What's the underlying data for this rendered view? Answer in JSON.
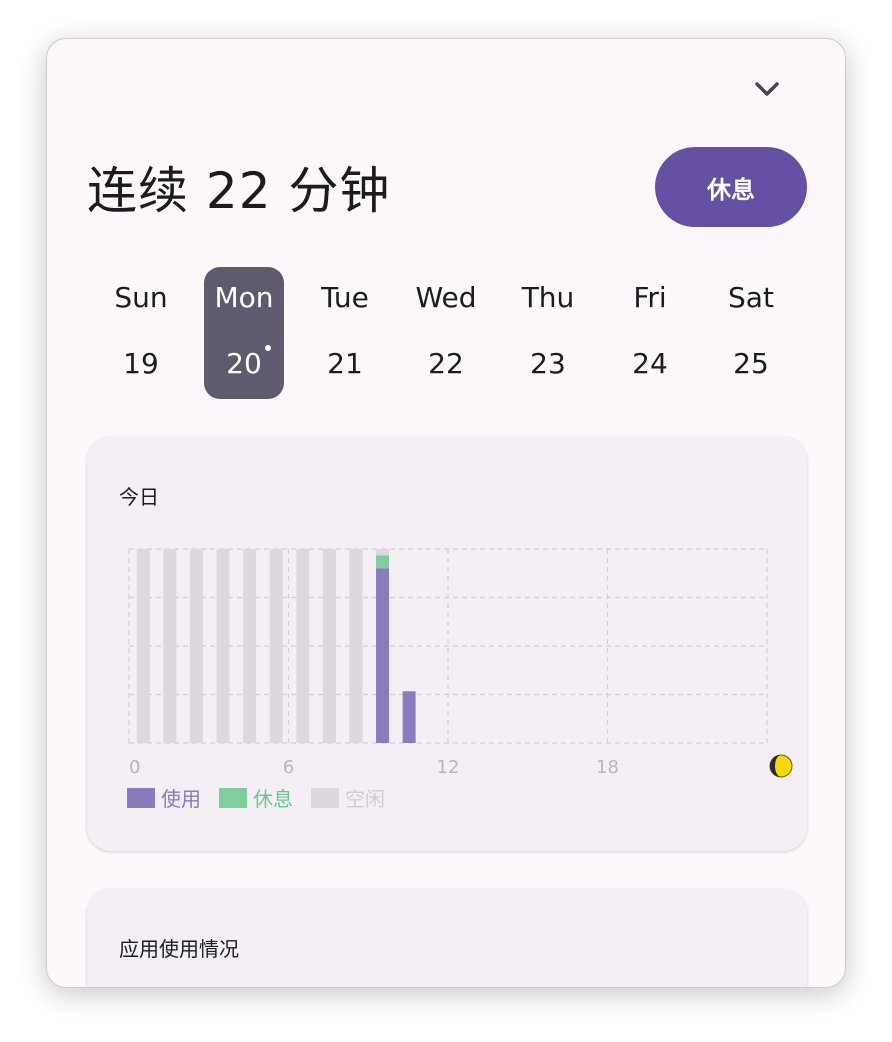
{
  "header": {
    "title": "连续 22 分钟",
    "break_button": "休息",
    "collapse_icon": "chevron-down-icon"
  },
  "week": {
    "days": [
      {
        "weekday": "Sun",
        "date": "19",
        "selected": false
      },
      {
        "weekday": "Mon",
        "date": "20",
        "selected": true,
        "today": true
      },
      {
        "weekday": "Tue",
        "date": "21",
        "selected": false
      },
      {
        "weekday": "Wed",
        "date": "22",
        "selected": false
      },
      {
        "weekday": "Thu",
        "date": "23",
        "selected": false
      },
      {
        "weekday": "Fri",
        "date": "24",
        "selected": false
      },
      {
        "weekday": "Sat",
        "date": "25",
        "selected": false
      }
    ]
  },
  "today_card": {
    "title": "今日",
    "night_icon": "moon-icon"
  },
  "apps_card": {
    "title": "应用使用情况"
  },
  "colors": {
    "accent": "#6650a4",
    "use": "#8a7bbd",
    "rest": "#7fcc9c",
    "idle": "#dcd8dd",
    "selected_day": "#5f5a6e"
  },
  "chart_data": {
    "type": "bar",
    "stacked": true,
    "x_ticks": [
      "0",
      "6",
      "12",
      "18"
    ],
    "x_range": [
      0,
      24
    ],
    "y_range": [
      0,
      60
    ],
    "y_unit": "minutes per hour",
    "grid": true,
    "legend_position": "bottom-left",
    "series": [
      {
        "name": "使用",
        "color": "#8a7bbd",
        "values": [
          0,
          0,
          0,
          0,
          0,
          0,
          0,
          0,
          0,
          54,
          16,
          0,
          0,
          0,
          0,
          0,
          0,
          0,
          0,
          0,
          0,
          0,
          0,
          0
        ]
      },
      {
        "name": "休息",
        "color": "#7fcc9c",
        "values": [
          0,
          0,
          0,
          0,
          0,
          0,
          0,
          0,
          0,
          4,
          0,
          0,
          0,
          0,
          0,
          0,
          0,
          0,
          0,
          0,
          0,
          0,
          0,
          0
        ]
      },
      {
        "name": "空闲",
        "color": "#dcd8dd",
        "values": [
          60,
          60,
          60,
          60,
          60,
          60,
          60,
          60,
          60,
          2,
          0,
          0,
          0,
          0,
          0,
          0,
          0,
          0,
          0,
          0,
          0,
          0,
          0,
          0
        ]
      }
    ]
  }
}
